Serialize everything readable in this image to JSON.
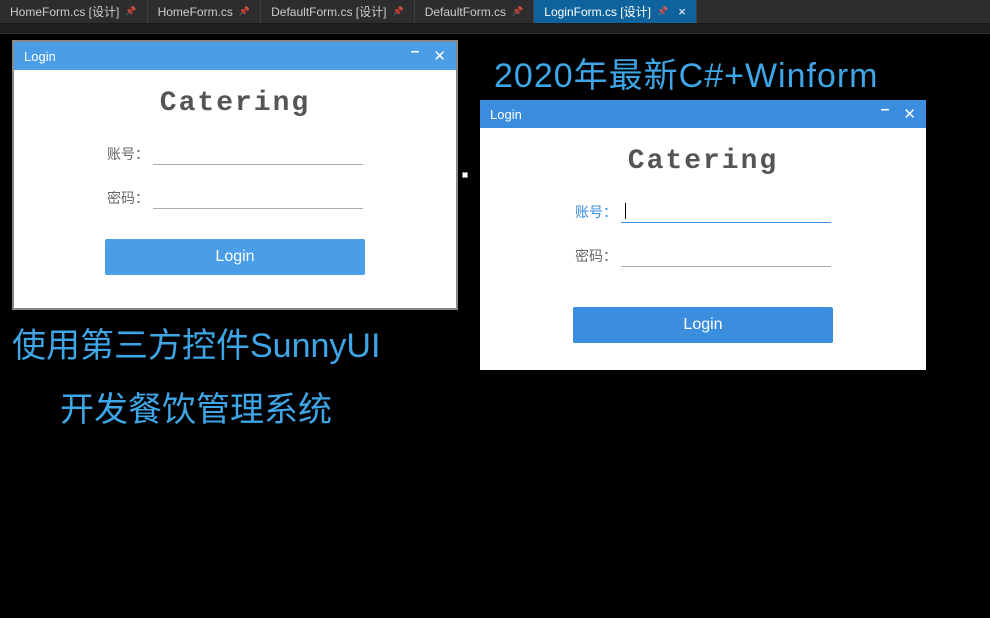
{
  "tabs": [
    {
      "label": "HomeForm.cs [设计]",
      "pin": true
    },
    {
      "label": "HomeForm.cs",
      "pin": true
    },
    {
      "label": "DefaultForm.cs [设计]",
      "pin": true
    },
    {
      "label": "DefaultForm.cs",
      "pin": true
    },
    {
      "label": "LoginForm.cs [设计]",
      "pin": true,
      "active": true
    }
  ],
  "banners": {
    "right": "2020年最新C#+Winform",
    "left1": "使用第三方控件SunnyUI",
    "left2": "开发餐饮管理系统"
  },
  "login": {
    "windowTitle": "Login",
    "appTitle": "Catering",
    "usernameLabel": "账号：",
    "passwordLabel": "密码：",
    "buttonLabel": "Login"
  }
}
